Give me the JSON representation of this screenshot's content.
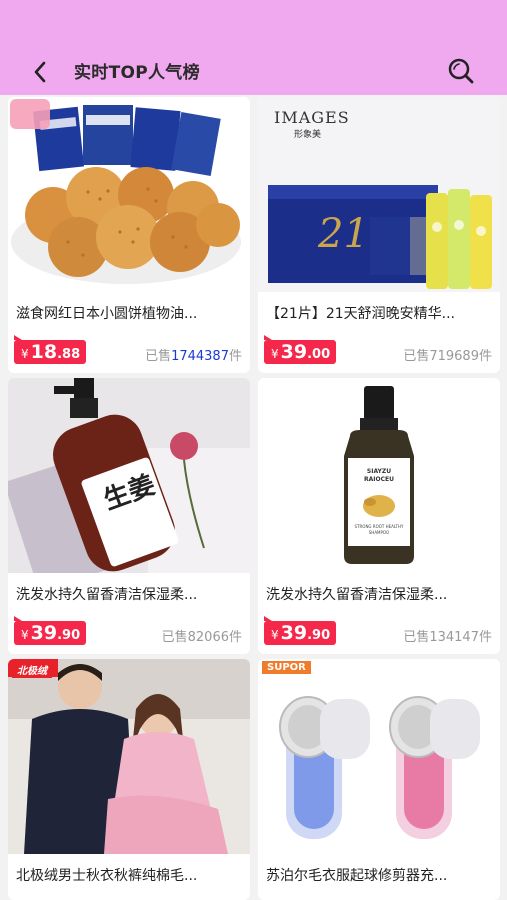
{
  "header": {
    "title": "实时TOP人气榜",
    "bg_color": "#f0a8ee"
  },
  "products": [
    {
      "name": "滋食网红日本小圆饼植物油...",
      "price_symbol": "¥",
      "price_int": "18",
      "price_dec": ".88",
      "sold_prefix": "已售",
      "sold_count": "1744387",
      "sold_suffix": "件",
      "image_label": "cookie-snack-image"
    },
    {
      "name": "【21片】21天舒润晚安精华...",
      "price_symbol": "¥",
      "price_int": "39",
      "price_dec": ".00",
      "sold_prefix": "已售",
      "sold_count": "719689",
      "sold_suffix": "件",
      "brand": "IMAGES",
      "brand_cn": "形象美",
      "box_text": "21"
    },
    {
      "name": "洗发水持久留香清洁保湿柔...",
      "price_symbol": "¥",
      "price_int": "39",
      "price_dec": ".90",
      "sold_prefix": "已售",
      "sold_count": "82066",
      "sold_suffix": "件",
      "bottle_text": "生姜"
    },
    {
      "name": "洗发水持久留香清洁保湿柔...",
      "price_symbol": "¥",
      "price_int": "39",
      "price_dec": ".90",
      "sold_prefix": "已售",
      "sold_count": "134147",
      "sold_suffix": "件",
      "label_brand": "SIAYZU RAIOCEU",
      "label_product": "STRONG ROOT HEALTHY SHAMPOO"
    },
    {
      "name": "北极绒男士秋衣秋裤纯棉毛...",
      "brand_badge": "北极绒"
    },
    {
      "name": "苏泊尔毛衣服起球修剪器充...",
      "brand_badge": "SUPOR"
    }
  ],
  "colors": {
    "price_red": "#f5274a",
    "sold_gray": "#999999",
    "sold_highlight": "#1a3ad8"
  }
}
